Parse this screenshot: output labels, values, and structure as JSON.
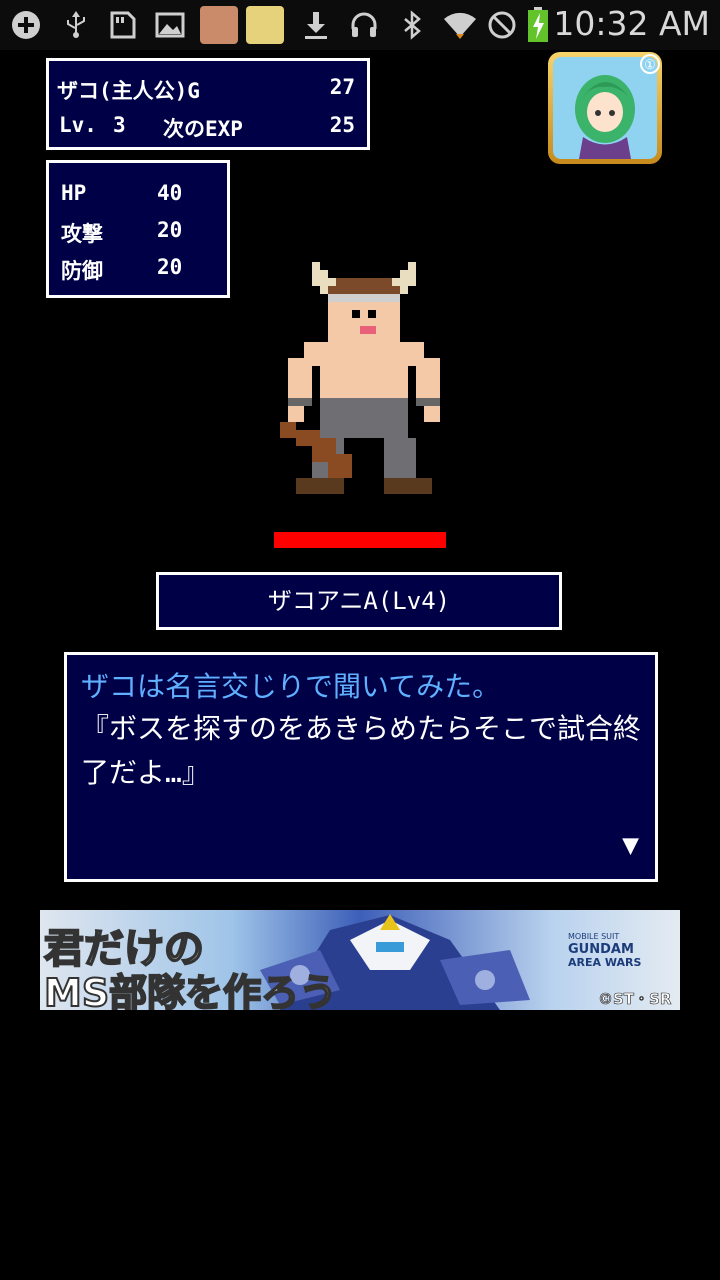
{
  "status_bar": {
    "time": "10:32 AM",
    "icons": [
      "add-icon",
      "usb-icon",
      "sd-card-icon",
      "image-icon",
      "app-icon",
      "app-icon-2",
      "download-icon",
      "headset-icon",
      "bluetooth-icon",
      "wifi-icon",
      "no-signal-icon",
      "battery-charging-icon"
    ]
  },
  "player": {
    "name": "ザコ(主人公)G",
    "gold": "27",
    "level_label": "Lv.",
    "level": "3",
    "next_exp_label": "次のEXP",
    "next_exp": "25"
  },
  "stats": [
    {
      "label": "HP",
      "value": "40"
    },
    {
      "label": "攻撃",
      "value": "20"
    },
    {
      "label": "防御",
      "value": "20"
    }
  ],
  "enemy": {
    "name": "ザコアニA(Lv4)",
    "hp_fraction": 1.0,
    "hp_color": "#ff0000"
  },
  "message": {
    "line1": "ザコは名言交じりで聞いてみた。",
    "line2": "『ボスを探すのをあきらめたらそこで試合終",
    "line3": "了だよ…』",
    "line1_color": "#5fb0ff",
    "next_indicator": "▼"
  },
  "banner": {
    "headline1": "君だけの",
    "headline2": "MS部隊を作ろう",
    "logo_small": "MOBILE SUIT",
    "logo_title1": "GUNDAM",
    "logo_title2": "AREA WARS",
    "copyright": "©ST・SR"
  },
  "colors": {
    "box_bg": "#000046",
    "border": "#ffffff"
  }
}
